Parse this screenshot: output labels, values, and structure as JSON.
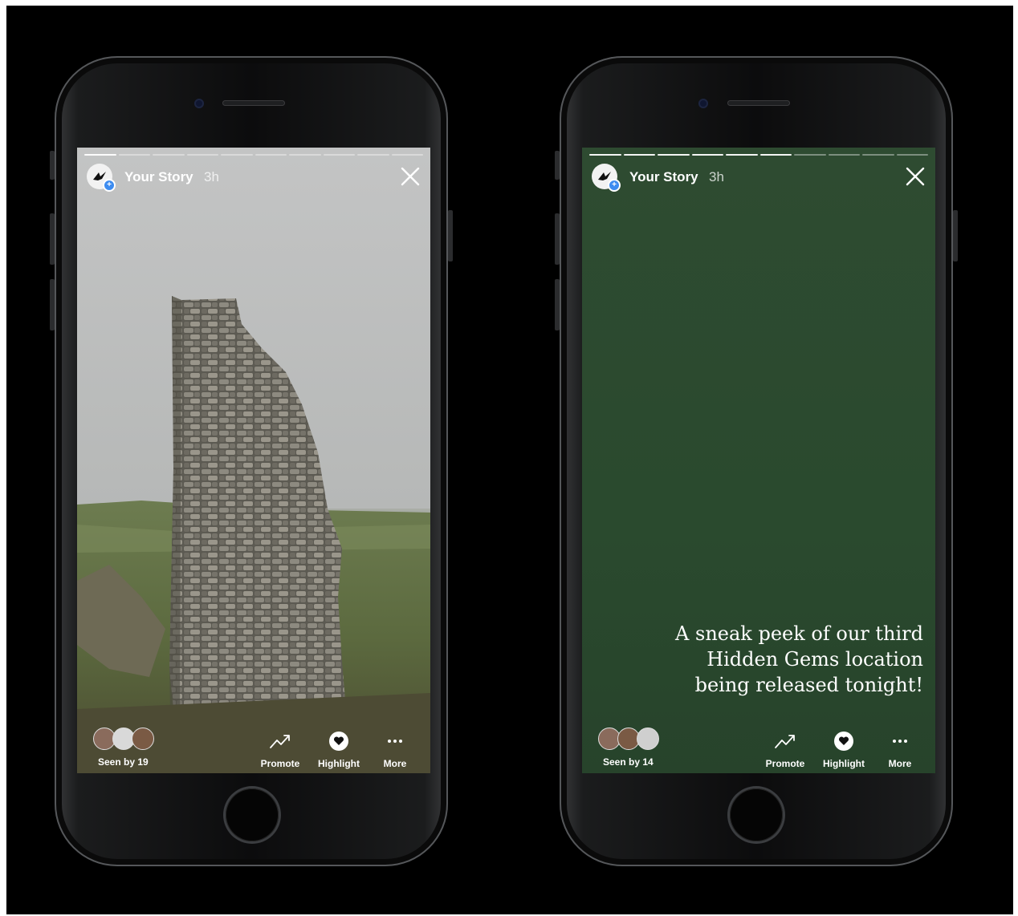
{
  "phones": [
    {
      "story": {
        "title": "Your Story",
        "time": "3h",
        "segments_total": 10,
        "segments_complete": 1
      },
      "bottom": {
        "seen_label": "Seen by 19",
        "promote_label": "Promote",
        "highlight_label": "Highlight",
        "more_label": "More"
      }
    },
    {
      "story": {
        "title": "Your Story",
        "time": "3h",
        "segments_total": 10,
        "segments_complete": 6,
        "caption": "A sneak peek of our third Hidden Gems location being released tonight!"
      },
      "bottom": {
        "seen_label": "Seen by 14",
        "promote_label": "Promote",
        "highlight_label": "Highlight",
        "more_label": "More"
      }
    }
  ],
  "colors": {
    "story_background_green": "#2b4a2f",
    "add_badge_blue": "#3d8cf0"
  },
  "icons": [
    "close-icon",
    "promote-icon",
    "highlight-icon",
    "more-icon",
    "add-badge-icon"
  ]
}
